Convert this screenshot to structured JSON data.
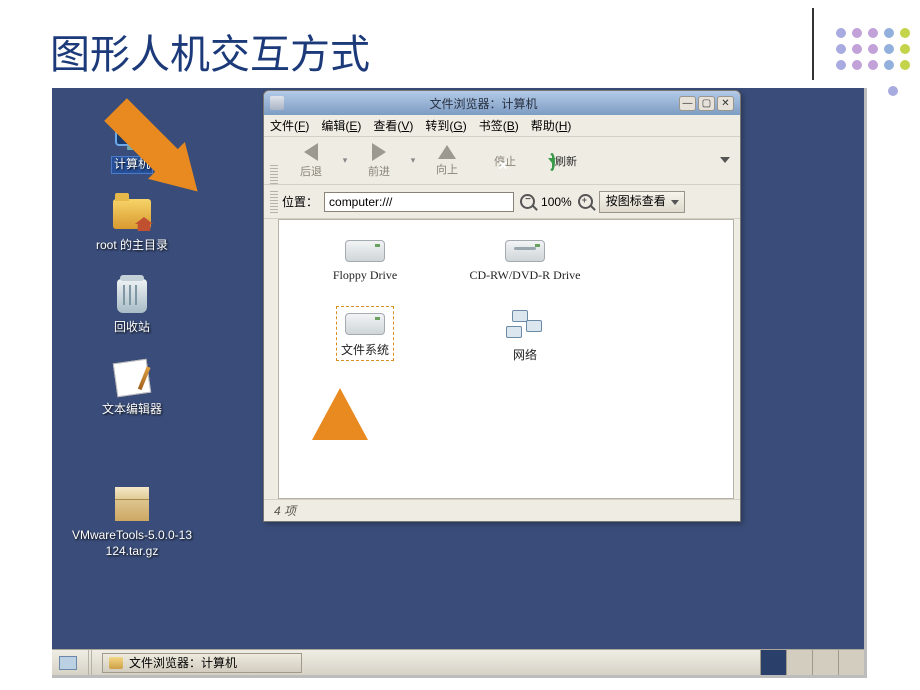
{
  "slide": {
    "title": "图形人机交互方式"
  },
  "dots": {
    "colors": [
      "#a7abe0",
      "#c1a1d8",
      "#c1a1d8",
      "#93b0dc",
      "#c3d34a",
      "#a7abe0",
      "#c1a1d8",
      "#c1a1d8",
      "#93b0dc",
      "#c3d34a",
      "#a7abe0",
      "#c1a1d8",
      "#c1a1d8",
      "#93b0dc",
      "#c3d34a"
    ]
  },
  "desktop_icons": {
    "computer": "计算机",
    "root_home": "root 的主目录",
    "trash": "回收站",
    "text_editor": "文本编辑器",
    "vmware_line1": "VMwareTools-5.0.0-13",
    "vmware_line2": "124.tar.gz"
  },
  "window": {
    "title": "文件浏览器：计算机",
    "menubar": {
      "file": "文件(F)",
      "edit": "编辑(E)",
      "view": "查看(V)",
      "go": "转到(G)",
      "bookmarks": "书签(B)",
      "help": "帮助(H)"
    },
    "toolbar": {
      "back": "后退",
      "forward": "前进",
      "up": "向上",
      "stop": "停止",
      "refresh": "刷新"
    },
    "locationbar": {
      "label": "位置：",
      "value": "computer:///",
      "zoom": "100%",
      "view_mode": "按图标查看"
    },
    "items": {
      "floppy": "Floppy Drive",
      "cdrw": "CD-RW/DVD-R Drive",
      "filesystem": "文件系统",
      "network": "网络"
    },
    "status": "4 项"
  },
  "taskbar": {
    "task1": "文件浏览器：计算机"
  }
}
